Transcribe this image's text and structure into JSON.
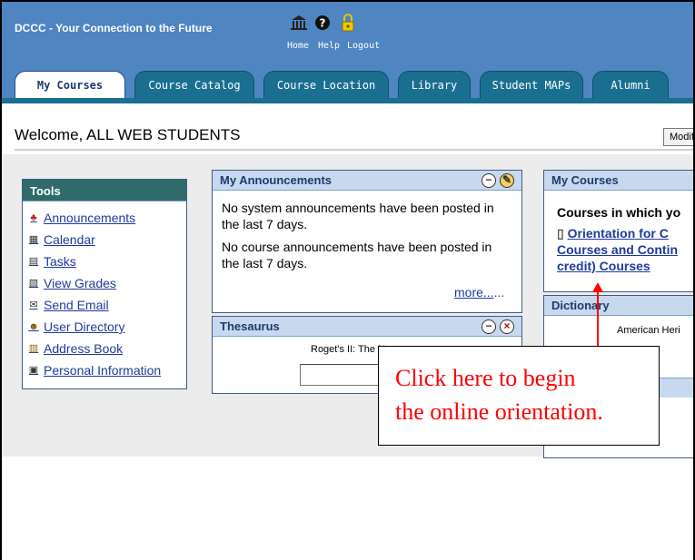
{
  "header": {
    "site_title": "DCCC - Your Connection to the Future",
    "links": [
      {
        "label": "Home",
        "icon": "building-icon"
      },
      {
        "label": "Help",
        "icon": "help-icon"
      },
      {
        "label": "Logout",
        "icon": "lock-icon"
      }
    ]
  },
  "tabs": [
    {
      "label": "My Courses",
      "active": true
    },
    {
      "label": "Course Catalog",
      "active": false
    },
    {
      "label": "Course Location",
      "active": false
    },
    {
      "label": "Library",
      "active": false
    },
    {
      "label": "Student MAPs",
      "active": false
    },
    {
      "label": "Alumni",
      "active": false
    }
  ],
  "welcome": {
    "text": "Welcome, ALL WEB STUDENTS",
    "modify_label": "Modif"
  },
  "tools": {
    "title": "Tools",
    "items": [
      {
        "label": "Announcements",
        "icon": "announcement-icon"
      },
      {
        "label": "Calendar",
        "icon": "calendar-icon"
      },
      {
        "label": "Tasks",
        "icon": "tasks-icon"
      },
      {
        "label": "View Grades",
        "icon": "grades-icon"
      },
      {
        "label": "Send Email",
        "icon": "email-icon"
      },
      {
        "label": "User Directory",
        "icon": "user-directory-icon"
      },
      {
        "label": "Address Book",
        "icon": "address-book-icon"
      },
      {
        "label": "Personal Information",
        "icon": "personal-info-icon"
      }
    ]
  },
  "announcements": {
    "title": "My Announcements",
    "system_text": "No system announcements have been posted in the last 7 days.",
    "course_text": "No course announcements have been posted in the last 7 days.",
    "more_link": "more...",
    "more_dots": "..."
  },
  "thesaurus": {
    "title": "Thesaurus",
    "source": "Roget's II: The Ne"
  },
  "my_courses": {
    "title": "My Courses",
    "subheading": "Courses in which yo",
    "course_line1": "Orientation for C",
    "course_line2": "Courses and Contin",
    "course_line3": "credit) Courses"
  },
  "dictionary": {
    "title": "Dictionary",
    "source": "American Heri"
  },
  "callout": {
    "line1": "Click here to begin",
    "line2": "the online orientation.",
    "color": "#ff0000"
  },
  "colors": {
    "header_blue": "#4f85c0",
    "tab_teal": "#1a6f90",
    "tools_header": "#2e6b6a",
    "panel_header": "#c8d8ee"
  }
}
